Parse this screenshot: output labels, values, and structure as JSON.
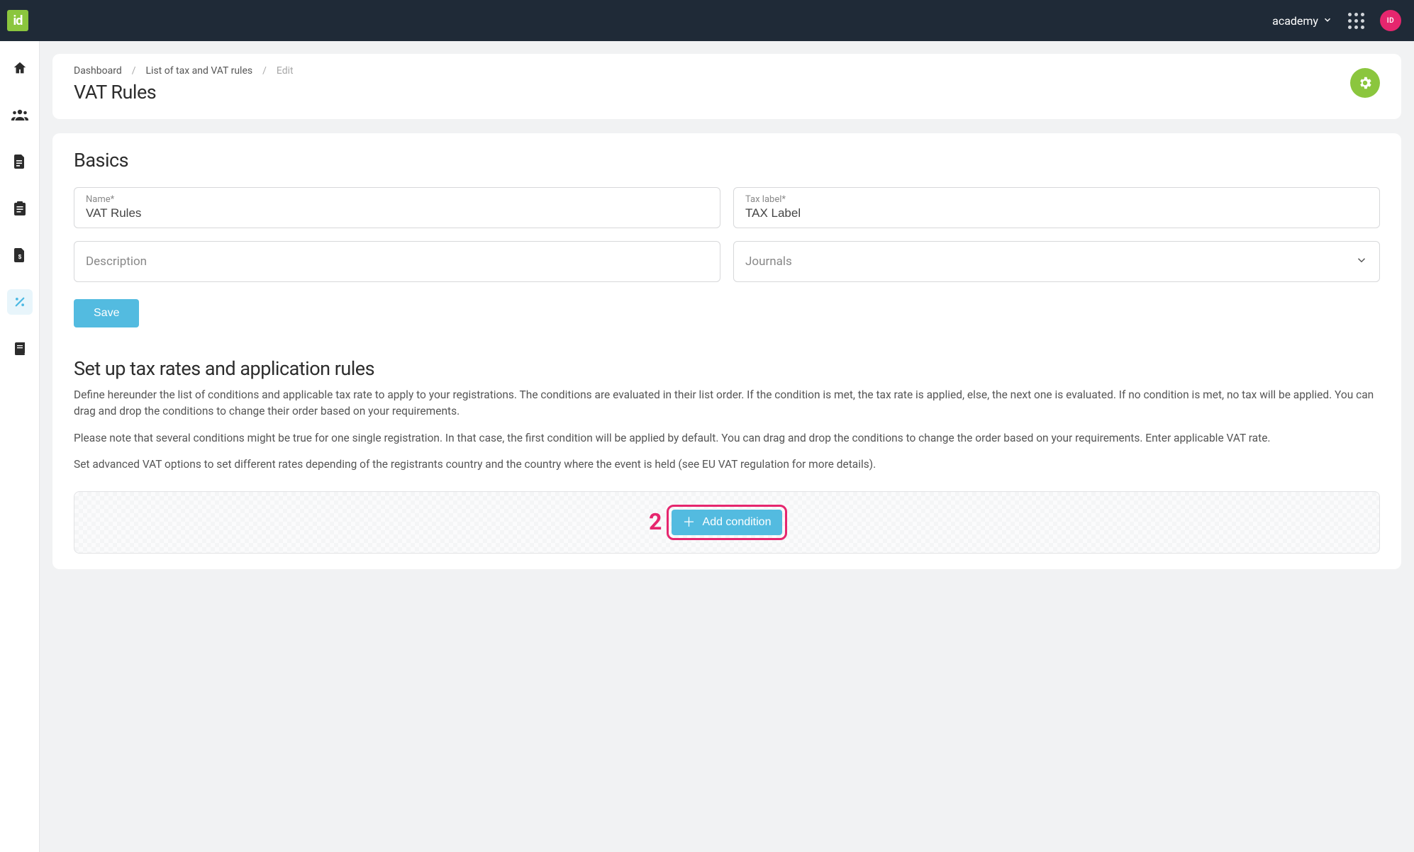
{
  "brand": {
    "logo_text": "id"
  },
  "topbar": {
    "account_label": "academy",
    "avatar_initials": "ID"
  },
  "breadcrumb": {
    "items": [
      {
        "label": "Dashboard",
        "muted": false
      },
      {
        "label": "List of tax and VAT rules",
        "muted": false
      },
      {
        "label": "Edit",
        "muted": true
      }
    ]
  },
  "page": {
    "title": "VAT Rules"
  },
  "basics": {
    "heading": "Basics",
    "name": {
      "label": "Name*",
      "value": "VAT Rules"
    },
    "tax_label": {
      "label": "Tax label*",
      "value": "TAX Label"
    },
    "description": {
      "placeholder": "Description",
      "value": ""
    },
    "journals": {
      "placeholder": "Journals",
      "value": ""
    },
    "save_label": "Save"
  },
  "rules": {
    "heading": "Set up tax rates and application rules",
    "p1": "Define hereunder the list of conditions and applicable tax rate to apply to your registrations. The conditions are evaluated in their list order. If the condition is met, the tax rate is applied, else, the next one is evaluated. If no condition is met, no tax will be applied. You can drag and drop the conditions to change their order based on your requirements.",
    "p2": "Please note that several conditions might be true for one single registration. In that case, the first condition will be applied by default. You can drag and drop the conditions to change the order based on your requirements. Enter applicable VAT rate.",
    "p3": "Set advanced VAT options to set different rates depending of the registrants country and the country where the event is held (see EU VAT regulation for more details).",
    "callout_number": "2",
    "add_condition_label": "Add condition"
  },
  "sidebar": {
    "items": [
      {
        "name": "home"
      },
      {
        "name": "users"
      },
      {
        "name": "document"
      },
      {
        "name": "clipboard"
      },
      {
        "name": "invoice"
      },
      {
        "name": "percent",
        "active": true
      },
      {
        "name": "book"
      }
    ]
  }
}
